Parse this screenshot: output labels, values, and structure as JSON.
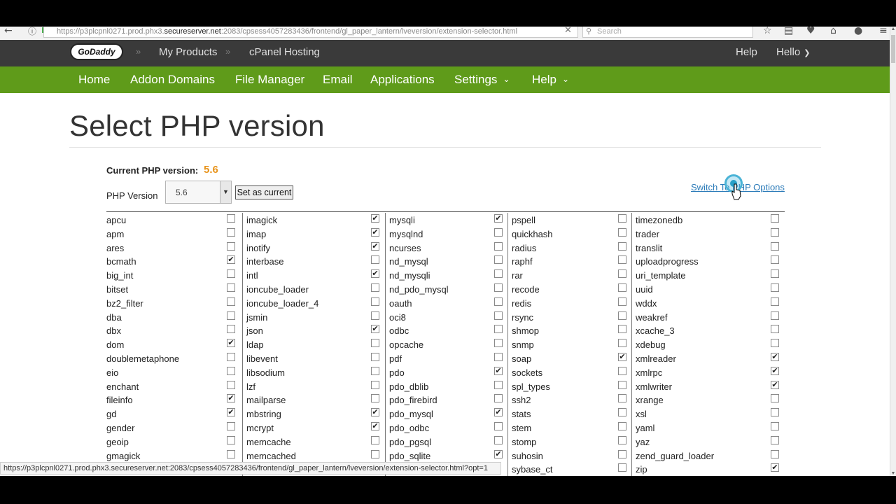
{
  "browser": {
    "url_prefix": "https://p3plcpnl0271.prod.phx3.",
    "url_host": "secureserver.net",
    "url_suffix": ":2083/cpsess4057283436/frontend/gl_paper_lantern/lveversion/extension-selector.html",
    "search_placeholder": "Search",
    "status_url": "https://p3plcpnl0271.prod.phx3.secureserver.net:2083/cpsess4057283436/frontend/gl_paper_lantern/lveversion/extension-selector.html?opt=1"
  },
  "header": {
    "logo_text": "GoDaddy",
    "breadcrumb_sep": "»",
    "my_products": "My Products",
    "cpanel_hosting": "cPanel Hosting",
    "help": "Help",
    "hello": "Hello"
  },
  "main_nav": {
    "home": "Home",
    "addon_domains": "Addon Domains",
    "file_manager": "File Manager",
    "email": "Email",
    "applications": "Applications",
    "settings": "Settings",
    "help": "Help"
  },
  "page": {
    "title": "Select PHP version",
    "current_version_label": "Current PHP version:",
    "current_version_value": "5.6",
    "php_version_label": "PHP Version",
    "php_version_selected": "5.6",
    "set_current_label": "Set as current",
    "switch_link": "Switch To PHP Options"
  },
  "extensions": [
    [
      {
        "name": "apcu",
        "checked": false
      },
      {
        "name": "apm",
        "checked": false
      },
      {
        "name": "ares",
        "checked": false
      },
      {
        "name": "bcmath",
        "checked": true
      },
      {
        "name": "big_int",
        "checked": false
      },
      {
        "name": "bitset",
        "checked": false
      },
      {
        "name": "bz2_filter",
        "checked": false
      },
      {
        "name": "dba",
        "checked": false
      },
      {
        "name": "dbx",
        "checked": false
      },
      {
        "name": "dom",
        "checked": true
      },
      {
        "name": "doublemetaphone",
        "checked": false
      },
      {
        "name": "eio",
        "checked": false
      },
      {
        "name": "enchant",
        "checked": false
      },
      {
        "name": "fileinfo",
        "checked": true
      },
      {
        "name": "gd",
        "checked": true
      },
      {
        "name": "gender",
        "checked": false
      },
      {
        "name": "geoip",
        "checked": false
      },
      {
        "name": "gmagick",
        "checked": false
      }
    ],
    [
      {
        "name": "imagick",
        "checked": true
      },
      {
        "name": "imap",
        "checked": true
      },
      {
        "name": "inotify",
        "checked": true
      },
      {
        "name": "interbase",
        "checked": false
      },
      {
        "name": "intl",
        "checked": true
      },
      {
        "name": "ioncube_loader",
        "checked": false
      },
      {
        "name": "ioncube_loader_4",
        "checked": false
      },
      {
        "name": "jsmin",
        "checked": false
      },
      {
        "name": "json",
        "checked": true
      },
      {
        "name": "ldap",
        "checked": false
      },
      {
        "name": "libevent",
        "checked": false
      },
      {
        "name": "libsodium",
        "checked": false
      },
      {
        "name": "lzf",
        "checked": false
      },
      {
        "name": "mailparse",
        "checked": false
      },
      {
        "name": "mbstring",
        "checked": true
      },
      {
        "name": "mcrypt",
        "checked": true
      },
      {
        "name": "memcache",
        "checked": false
      },
      {
        "name": "memcached",
        "checked": false
      }
    ],
    [
      {
        "name": "mysqli",
        "checked": true
      },
      {
        "name": "mysqlnd",
        "checked": false
      },
      {
        "name": "ncurses",
        "checked": false
      },
      {
        "name": "nd_mysql",
        "checked": false
      },
      {
        "name": "nd_mysqli",
        "checked": false
      },
      {
        "name": "nd_pdo_mysql",
        "checked": false
      },
      {
        "name": "oauth",
        "checked": false
      },
      {
        "name": "oci8",
        "checked": false
      },
      {
        "name": "odbc",
        "checked": false
      },
      {
        "name": "opcache",
        "checked": false
      },
      {
        "name": "pdf",
        "checked": false
      },
      {
        "name": "pdo",
        "checked": true
      },
      {
        "name": "pdo_dblib",
        "checked": false
      },
      {
        "name": "pdo_firebird",
        "checked": false
      },
      {
        "name": "pdo_mysql",
        "checked": true
      },
      {
        "name": "pdo_odbc",
        "checked": false
      },
      {
        "name": "pdo_pgsql",
        "checked": false
      },
      {
        "name": "pdo_sqlite",
        "checked": true
      }
    ],
    [
      {
        "name": "pspell",
        "checked": false
      },
      {
        "name": "quickhash",
        "checked": false
      },
      {
        "name": "radius",
        "checked": false
      },
      {
        "name": "raphf",
        "checked": false
      },
      {
        "name": "rar",
        "checked": false
      },
      {
        "name": "recode",
        "checked": false
      },
      {
        "name": "redis",
        "checked": false
      },
      {
        "name": "rsync",
        "checked": false
      },
      {
        "name": "shmop",
        "checked": false
      },
      {
        "name": "snmp",
        "checked": false
      },
      {
        "name": "soap",
        "checked": true
      },
      {
        "name": "sockets",
        "checked": false
      },
      {
        "name": "spl_types",
        "checked": false
      },
      {
        "name": "ssh2",
        "checked": false
      },
      {
        "name": "stats",
        "checked": false
      },
      {
        "name": "stem",
        "checked": false
      },
      {
        "name": "stomp",
        "checked": false
      },
      {
        "name": "suhosin",
        "checked": false
      },
      {
        "name": "sybase_ct",
        "checked": false
      }
    ],
    [
      {
        "name": "timezonedb",
        "checked": false
      },
      {
        "name": "trader",
        "checked": false
      },
      {
        "name": "translit",
        "checked": false
      },
      {
        "name": "uploadprogress",
        "checked": false
      },
      {
        "name": "uri_template",
        "checked": false
      },
      {
        "name": "uuid",
        "checked": false
      },
      {
        "name": "wddx",
        "checked": false
      },
      {
        "name": "weakref",
        "checked": false
      },
      {
        "name": "xcache_3",
        "checked": false
      },
      {
        "name": "xdebug",
        "checked": false
      },
      {
        "name": "xmlreader",
        "checked": true
      },
      {
        "name": "xmlrpc",
        "checked": true
      },
      {
        "name": "xmlwriter",
        "checked": true
      },
      {
        "name": "xrange",
        "checked": false
      },
      {
        "name": "xsl",
        "checked": false
      },
      {
        "name": "yaml",
        "checked": false
      },
      {
        "name": "yaz",
        "checked": false
      },
      {
        "name": "zend_guard_loader",
        "checked": false
      },
      {
        "name": "zip",
        "checked": true
      }
    ]
  ],
  "icons": {
    "back": "back-arrow-icon",
    "info": "info-icon",
    "lock": "lock-icon",
    "search": "search-icon",
    "bookmark": "bookmark-star-icon",
    "reading_list": "reading-list-icon",
    "pocket": "pocket-icon",
    "home": "home-icon",
    "sync": "sync-icon",
    "menu": "menu-icon",
    "dropdown": "chevron-down-icon",
    "cursor": "mouse-pointer-icon"
  },
  "colors": {
    "brand_green": "#5f9b1a",
    "top_bar": "#3a3a3a",
    "version_accent": "#e8931a",
    "link": "#2a7ab8"
  }
}
